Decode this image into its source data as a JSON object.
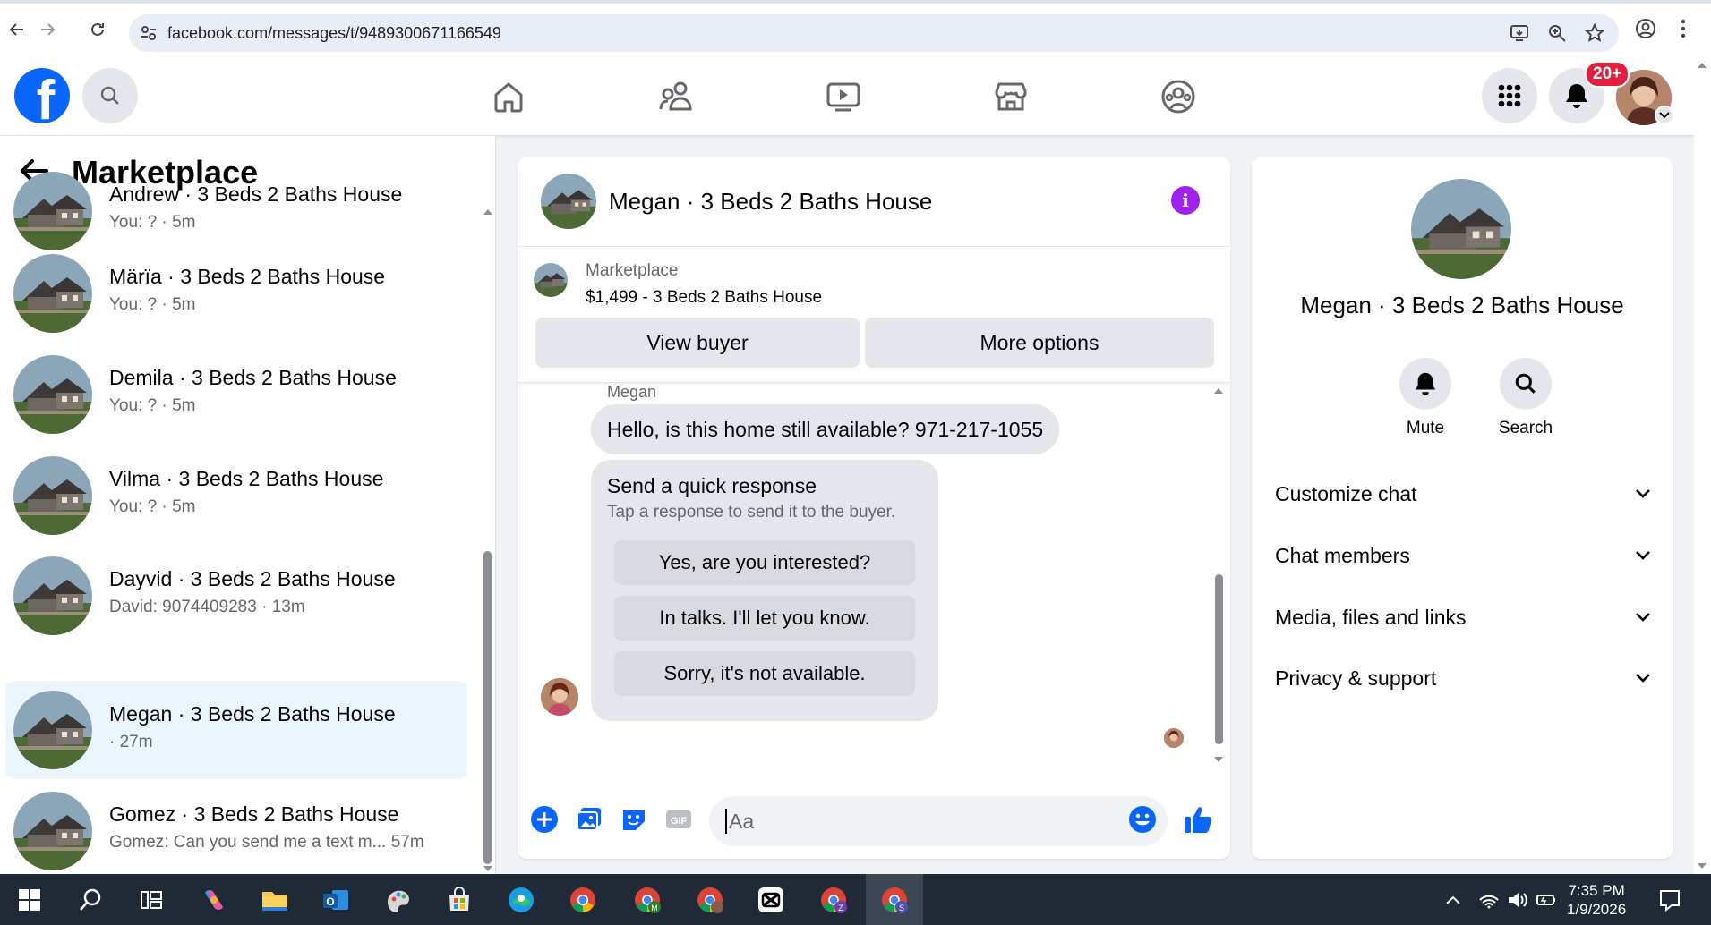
{
  "browser": {
    "url": "facebook.com/messages/t/9489300671166549"
  },
  "header": {
    "logo_letter": "f",
    "notification_count": "20+"
  },
  "sidebar": {
    "title": "Marketplace",
    "conversations": [
      {
        "name": "Andrew · 3 Beds 2 Baths House",
        "preview": "You: ? · 5m"
      },
      {
        "name": "Märïa · 3 Beds 2 Baths House",
        "preview": "You: ? · 5m"
      },
      {
        "name": "Demila · 3 Beds 2 Baths House",
        "preview": "You: ? · 5m"
      },
      {
        "name": "Vilma · 3 Beds 2 Baths House",
        "preview": "You: ? · 5m"
      },
      {
        "name": "Dayvid · 3 Beds 2 Baths House",
        "preview": "David: 9074409283 · 13m"
      },
      {
        "name": "Megan · 3 Beds 2 Baths House",
        "preview": "· 27m"
      },
      {
        "name": "Gomez · 3 Beds 2 Baths House",
        "preview": "Gomez: Can you send me a text m... 57m"
      }
    ]
  },
  "chat": {
    "title": "Megan · 3 Beds 2 Baths House",
    "marketplace_label": "Marketplace",
    "listing": "$1,499 - 3 Beds 2 Baths House",
    "view_buyer": "View buyer",
    "more_options": "More options",
    "sender": "Megan",
    "message": "Hello, is this home still available? 971-217-1055",
    "quick_title": "Send a quick response",
    "quick_subtitle": "Tap a response to send it to the buyer.",
    "quick_responses": [
      "Yes, are you interested?",
      "In talks. I'll let you know.",
      "Sorry, it's not available."
    ],
    "composer_placeholder": "Aa"
  },
  "details": {
    "name": "Megan · 3 Beds 2 Baths House",
    "mute": "Mute",
    "search": "Search",
    "sections": [
      "Customize chat",
      "Chat members",
      "Media, files and links",
      "Privacy & support"
    ]
  },
  "taskbar": {
    "time": "7:35 PM",
    "date": "1/9/2026"
  },
  "colors": {
    "fb_blue": "#0866ff",
    "active_conversation": "#ebf5ff",
    "info_purple": "#a020f0",
    "badge_red": "#e41e3f"
  }
}
